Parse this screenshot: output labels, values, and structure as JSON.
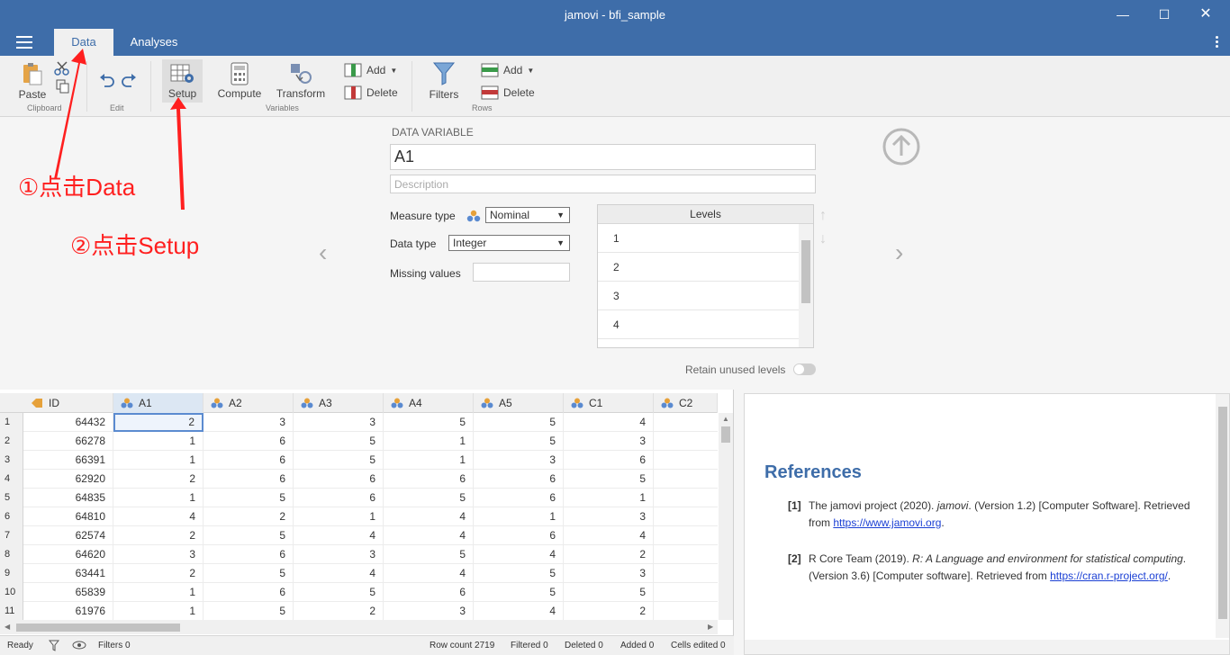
{
  "window": {
    "title": "jamovi - bfi_sample"
  },
  "tabs": [
    {
      "label": "Data"
    },
    {
      "label": "Analyses"
    }
  ],
  "ribbon": {
    "paste": "Paste",
    "clipboard_group": "Clipboard",
    "edit_group": "Edit",
    "setup": "Setup",
    "compute": "Compute",
    "transform": "Transform",
    "var_add": "Add",
    "var_delete": "Delete",
    "variables_group": "Variables",
    "filters": "Filters",
    "row_add": "Add",
    "row_delete": "Delete",
    "rows_group": "Rows"
  },
  "setup": {
    "section_label": "DATA VARIABLE",
    "variable_name": "A1",
    "description_placeholder": "Description",
    "measure_type_label": "Measure type",
    "measure_type_value": "Nominal",
    "data_type_label": "Data type",
    "data_type_value": "Integer",
    "missing_values_label": "Missing values",
    "levels_header": "Levels",
    "levels": [
      "1",
      "2",
      "3",
      "4"
    ],
    "retain_unused_label": "Retain unused levels",
    "retain_unused_on": false
  },
  "annotations": {
    "step1": "①点击Data",
    "step2": "②点击Setup",
    "color": "#ff1f1f"
  },
  "grid": {
    "columns": [
      "ID",
      "A1",
      "A2",
      "A3",
      "A4",
      "A5",
      "C1",
      "C2"
    ],
    "rows": [
      [
        "1",
        "64432",
        "2",
        "3",
        "3",
        "5",
        "5",
        "4"
      ],
      [
        "2",
        "66278",
        "1",
        "6",
        "5",
        "1",
        "5",
        "3"
      ],
      [
        "3",
        "66391",
        "1",
        "6",
        "5",
        "1",
        "3",
        "6"
      ],
      [
        "4",
        "62920",
        "2",
        "6",
        "6",
        "6",
        "6",
        "5"
      ],
      [
        "5",
        "64835",
        "1",
        "5",
        "6",
        "5",
        "6",
        "1"
      ],
      [
        "6",
        "64810",
        "4",
        "2",
        "1",
        "4",
        "1",
        "3"
      ],
      [
        "7",
        "62574",
        "2",
        "5",
        "4",
        "4",
        "6",
        "4"
      ],
      [
        "8",
        "64620",
        "3",
        "6",
        "3",
        "5",
        "4",
        "2"
      ],
      [
        "9",
        "63441",
        "2",
        "5",
        "4",
        "4",
        "5",
        "3"
      ],
      [
        "10",
        "65839",
        "1",
        "6",
        "5",
        "6",
        "5",
        "5"
      ],
      [
        "11",
        "61976",
        "1",
        "5",
        "2",
        "3",
        "4",
        "2"
      ]
    ]
  },
  "results": {
    "title": "References",
    "refs": [
      {
        "num": "[1]",
        "pre": "The jamovi project (2020). ",
        "italic": "jamovi",
        "post": ". (Version 1.2) [Computer Software]. Retrieved from ",
        "link": "https://www.jamovi.org",
        "end": "."
      },
      {
        "num": "[2]",
        "pre": "R Core Team (2019). ",
        "italic": "R: A Language and environment for statistical computing",
        "post": ". (Version 3.6) [Computer software]. Retrieved from ",
        "link": "https://cran.r-project.org/",
        "end": "."
      }
    ]
  },
  "status": {
    "ready": "Ready",
    "filters": "Filters 0",
    "row_count": "Row count 2719",
    "filtered": "Filtered 0",
    "deleted": "Deleted 0",
    "added": "Added 0",
    "cells_edited": "Cells edited 0"
  },
  "colors": {
    "brand": "#3e6da9",
    "link": "#1a3fd4",
    "annotation": "#ff1f1f"
  },
  "icons": [
    "hamburger-icon",
    "paste-icon",
    "cut-icon",
    "copy-icon",
    "undo-icon",
    "redo-icon",
    "setup-icon",
    "compute-icon",
    "transform-icon",
    "add-variable-icon",
    "delete-variable-icon",
    "filter-icon",
    "add-row-icon",
    "delete-row-icon",
    "nominal-icon",
    "id-icon",
    "eye-icon",
    "up-arrow-circle-icon"
  ]
}
